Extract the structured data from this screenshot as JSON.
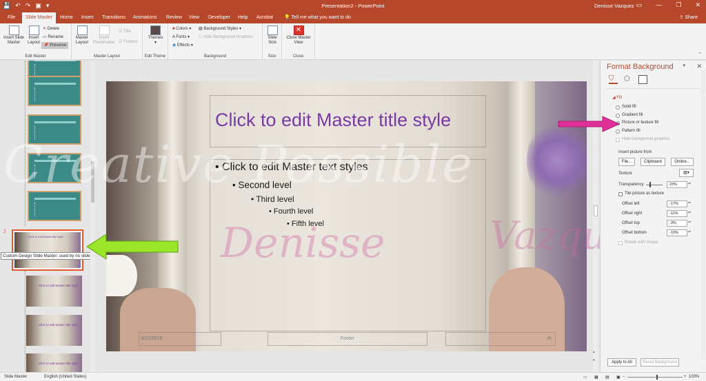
{
  "window": {
    "title": "Presentation2 - PowerPoint",
    "user": "Denisse Vazquez",
    "controls": [
      "minimize",
      "restore",
      "close"
    ]
  },
  "tabs": [
    {
      "label": "File",
      "active": false
    },
    {
      "label": "Slide Master",
      "active": true
    },
    {
      "label": "Home",
      "active": false
    },
    {
      "label": "Insert",
      "active": false
    },
    {
      "label": "Transitions",
      "active": false
    },
    {
      "label": "Animations",
      "active": false
    },
    {
      "label": "Review",
      "active": false
    },
    {
      "label": "View",
      "active": false
    },
    {
      "label": "Developer",
      "active": false
    },
    {
      "label": "Help",
      "active": false
    },
    {
      "label": "Acrobat",
      "active": false
    }
  ],
  "tellme": "Tell me what you want to do",
  "share": "Share",
  "ribbon": {
    "edit_master": {
      "label": "Edit Master",
      "insert_slide_master": "Insert Slide Master",
      "insert_layout": "Insert Layout",
      "delete": "Delete",
      "rename": "Rename",
      "preserve": "Preserve"
    },
    "master_layout": {
      "label": "Master Layout",
      "master_layout": "Master Layout",
      "insert_placeholder": "Insert Placeholder",
      "title": "Title",
      "footers": "Footers"
    },
    "edit_theme": {
      "label": "Edit Theme",
      "themes": "Themes"
    },
    "background": {
      "label": "Background",
      "colors": "Colors",
      "fonts": "Fonts",
      "effects": "Effects",
      "background_styles": "Background Styles",
      "hide_bg_graphics": "Hide Background Graphics"
    },
    "size": {
      "label": "Size",
      "slide_size": "Slide Size"
    },
    "close": {
      "label": "Close",
      "close_master_view": "Close Master View"
    }
  },
  "thumbnails": {
    "selected_number": "2",
    "tooltip": "Custom Design Slide Master: used by no slides",
    "selected_title": "Click to edit Master title style",
    "photo_texts": [
      "Click to edit Master title style",
      "Click to edit Master title style",
      "Click to edit Master title style",
      "Click to edit Master title style"
    ]
  },
  "slide": {
    "title": "Click to edit Master title style",
    "levels": [
      "• Click to edit Master text styles",
      "• Second level",
      "• Third level",
      "• Fourth level",
      "• Fifth level"
    ],
    "date": "3/22/2019",
    "footer": "Footer",
    "number": "‹#›"
  },
  "watermark": {
    "line1": "Creative Possible",
    "line2": "Denisse",
    "line3": "Vazquez"
  },
  "pane": {
    "title": "Format Background",
    "fill_header": "Fill",
    "options": [
      "Solid fill",
      "Gradient fill",
      "Picture or texture fill",
      "Pattern fill"
    ],
    "selected_option": "Picture or texture fill",
    "hide_bg": "Hide background graphics",
    "insert_from": "Insert picture from",
    "file": "File...",
    "clipboard": "Clipboard",
    "online": "Online...",
    "texture": "Texture",
    "transparency": "Transparency",
    "transparency_value": "23%",
    "tile": "Tile picture as texture",
    "offset_left": "Offset left",
    "offset_left_value": "-17%",
    "offset_right": "Offset right",
    "offset_right_value": "-11%",
    "offset_top": "Offset top",
    "offset_top_value": "-3%",
    "offset_bottom": "Offset bottom",
    "offset_bottom_value": "-10%",
    "rotate": "Rotate with shape",
    "apply_all": "Apply to All",
    "reset": "Reset Background"
  },
  "status": {
    "view": "Slide Master",
    "language": "English (United States)",
    "zoom": "103%"
  },
  "colors": {
    "accent": "#b7472a",
    "title_purple": "#7a3aa5",
    "arrow_green": "#9be52a",
    "arrow_pink": "#e0309a"
  }
}
